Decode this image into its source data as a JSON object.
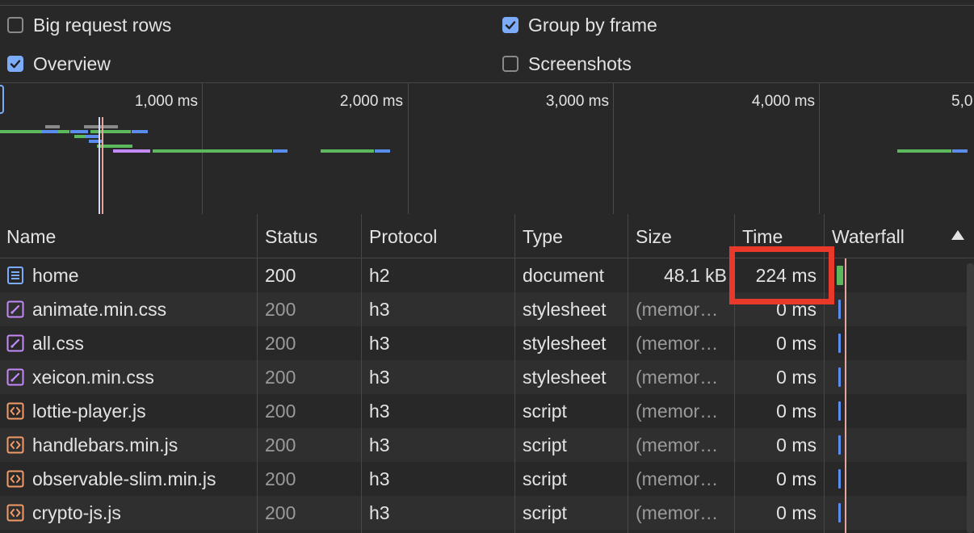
{
  "settings": {
    "big_request_rows": {
      "label": "Big request rows",
      "checked": false
    },
    "group_by_frame": {
      "label": "Group by frame",
      "checked": true
    },
    "overview": {
      "label": "Overview",
      "checked": true
    },
    "screenshots": {
      "label": "Screenshots",
      "checked": false
    }
  },
  "overview": {
    "ticks": [
      "1,000 ms",
      "2,000 ms",
      "3,000 ms",
      "4,000 ms",
      "5,0"
    ]
  },
  "table": {
    "columns": {
      "name": "Name",
      "status": "Status",
      "protocol": "Protocol",
      "type": "Type",
      "size": "Size",
      "time": "Time",
      "waterfall": "Waterfall"
    },
    "rows": [
      {
        "name": "home",
        "status": "200",
        "protocol": "h2",
        "type": "document",
        "size": "48.1 kB",
        "time": "224 ms",
        "icon": "document-icon"
      },
      {
        "name": "animate.min.css",
        "status": "200",
        "protocol": "h3",
        "type": "stylesheet",
        "size": "(memor…",
        "time": "0 ms",
        "icon": "stylesheet-icon"
      },
      {
        "name": "all.css",
        "status": "200",
        "protocol": "h3",
        "type": "stylesheet",
        "size": "(memor…",
        "time": "0 ms",
        "icon": "stylesheet-icon"
      },
      {
        "name": "xeicon.min.css",
        "status": "200",
        "protocol": "h3",
        "type": "stylesheet",
        "size": "(memor…",
        "time": "0 ms",
        "icon": "stylesheet-icon"
      },
      {
        "name": "lottie-player.js",
        "status": "200",
        "protocol": "h3",
        "type": "script",
        "size": "(memor…",
        "time": "0 ms",
        "icon": "script-icon"
      },
      {
        "name": "handlebars.min.js",
        "status": "200",
        "protocol": "h3",
        "type": "script",
        "size": "(memor…",
        "time": "0 ms",
        "icon": "script-icon"
      },
      {
        "name": "observable-slim.min.js",
        "status": "200",
        "protocol": "h3",
        "type": "script",
        "size": "(memor…",
        "time": "0 ms",
        "icon": "script-icon"
      },
      {
        "name": "crypto-js.js",
        "status": "200",
        "protocol": "h3",
        "type": "script",
        "size": "(memor…",
        "time": "0 ms",
        "icon": "script-icon"
      }
    ]
  },
  "colors": {
    "accent": "#7cacf8",
    "highlight_box": "#e8392a",
    "bar_green": "#5cb85c",
    "bar_blue": "#5b8def",
    "bar_purple": "#c58af9",
    "bar_gray": "#8a8a8a"
  }
}
